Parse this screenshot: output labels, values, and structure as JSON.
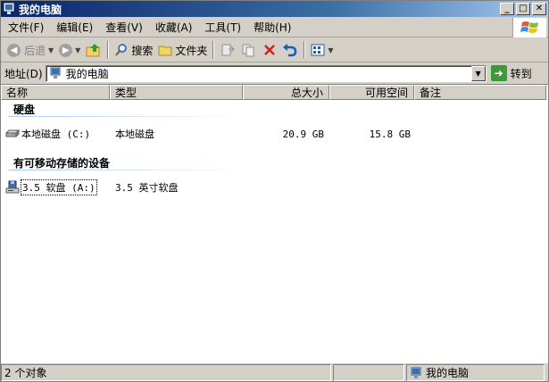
{
  "window": {
    "title": "我的电脑"
  },
  "menu": {
    "items": [
      {
        "label": "文件(F)"
      },
      {
        "label": "编辑(E)"
      },
      {
        "label": "查看(V)"
      },
      {
        "label": "收藏(A)"
      },
      {
        "label": "工具(T)"
      },
      {
        "label": "帮助(H)"
      }
    ]
  },
  "toolbar": {
    "back_label": "后退",
    "search_label": "搜索",
    "folders_label": "文件夹"
  },
  "address": {
    "label": "地址(D)",
    "value": "我的电脑",
    "go_label": "转到"
  },
  "columns": [
    {
      "label": "名称"
    },
    {
      "label": "类型"
    },
    {
      "label": "总大小"
    },
    {
      "label": "可用空间"
    },
    {
      "label": "备注"
    }
  ],
  "groups": [
    {
      "title": "硬盘",
      "items": [
        {
          "name": "本地磁盘 (C:)",
          "type": "本地磁盘",
          "total": "20.9 GB",
          "free": "15.8 GB",
          "icon": "hard-drive-icon"
        }
      ]
    },
    {
      "title": "有可移动存储的设备",
      "items": [
        {
          "name": "3.5 软盘 (A:)",
          "type": "3.5 英寸软盘",
          "total": "",
          "free": "",
          "icon": "floppy-drive-icon"
        }
      ]
    }
  ],
  "status": {
    "count_text": "2 个对象",
    "location_text": "我的电脑"
  },
  "colors": {
    "title_start": "#0a246a",
    "title_end": "#a6caf0",
    "chrome": "#d4d0c8"
  }
}
